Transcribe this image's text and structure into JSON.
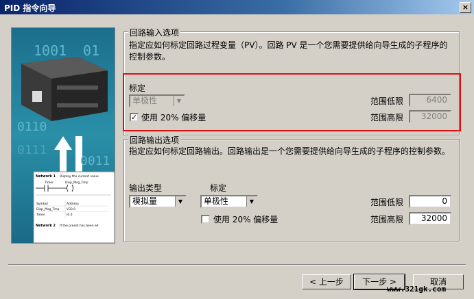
{
  "window": {
    "title": "PID 指令向导",
    "close_label": "×"
  },
  "illustration": {
    "binary_top": "1001",
    "binary_top2": "01",
    "binary_mid": "0110",
    "binary_mid2": "0011",
    "binary_low": "0111",
    "network1_label": "Network 1",
    "network1_comment": "Display the current value",
    "contact_label": "Timer",
    "coil_label": "Disp_Msg_Tmp",
    "table_rows": [
      [
        "Symbol",
        "Address"
      ],
      [
        "Disp_Msg_Tmp",
        "V33.0"
      ],
      [
        "Timer",
        "I0.0"
      ]
    ],
    "network2_label": "Network 2",
    "network2_comment": "If the preset has been ed"
  },
  "input_group": {
    "title": "回路输入选项",
    "description": "指定应如何标定回路过程变量（PV）。回路 PV 是一个您需要提供给向导生成的子程序的控制参数。",
    "scaling_label": "标定",
    "scaling_value": "单极性",
    "offset_label": "使用 20% 偏移量",
    "offset_checked": "✓",
    "low_label": "范围低限",
    "low_value": "6400",
    "high_label": "范围高限",
    "high_value": "32000"
  },
  "output_group": {
    "title": "回路输出选项",
    "description": "指定应如何标定回路输出。回路输出是一个您需要提供给向导生成的子程序的控制参数。",
    "type_label": "输出类型",
    "type_value": "模拟量",
    "scaling_label": "标定",
    "scaling_value": "单极性",
    "offset_label": "使用 20% 偏移量",
    "offset_checked": "",
    "low_label": "范围低限",
    "low_value": "0",
    "high_label": "范围高限",
    "high_value": "32000"
  },
  "buttons": {
    "back": "< 上一步",
    "next": "下一步 >",
    "cancel": "取消"
  },
  "watermark": "www.321gk.com"
}
